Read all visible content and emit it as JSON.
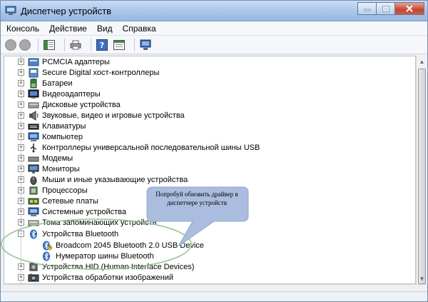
{
  "window": {
    "title": "Диспетчер устройств"
  },
  "menu": [
    "Консоль",
    "Действие",
    "Вид",
    "Справка"
  ],
  "toolbar": {
    "buttons": [
      "back",
      "forward",
      "show-hide-console-tree",
      "print",
      "help",
      "properties",
      "scan-hardware"
    ]
  },
  "tree": {
    "items": [
      {
        "label": "PCMCIA адаптеры",
        "icon": "pcmcia-icon",
        "expander": "+"
      },
      {
        "label": "Secure Digital хост-контроллеры",
        "icon": "sd-host-icon",
        "expander": "+"
      },
      {
        "label": "Батареи",
        "icon": "battery-icon",
        "expander": "+"
      },
      {
        "label": "Видеоадаптеры",
        "icon": "display-adapter-icon",
        "expander": "+"
      },
      {
        "label": "Дисковые устройства",
        "icon": "disk-drive-icon",
        "expander": "+"
      },
      {
        "label": "Звуковые, видео и игровые устройства",
        "icon": "sound-icon",
        "expander": "+"
      },
      {
        "label": "Клавиатуры",
        "icon": "keyboard-icon",
        "expander": "+"
      },
      {
        "label": "Компьютер",
        "icon": "computer-icon",
        "expander": "+"
      },
      {
        "label": "Контроллеры универсальной последовательной шины USB",
        "icon": "usb-icon",
        "expander": "+"
      },
      {
        "label": "Модемы",
        "icon": "modem-icon",
        "expander": "+"
      },
      {
        "label": "Мониторы",
        "icon": "monitor-icon",
        "expander": "+"
      },
      {
        "label": "Мыши и иные указывающие устройства",
        "icon": "mouse-icon",
        "expander": "+"
      },
      {
        "label": "Процессоры",
        "icon": "processor-icon",
        "expander": "+"
      },
      {
        "label": "Сетевые платы",
        "icon": "network-icon",
        "expander": "+"
      },
      {
        "label": "Системные устройства",
        "icon": "system-device-icon",
        "expander": "+"
      },
      {
        "label": "Тома запоминающих устройств",
        "icon": "storage-volume-icon",
        "expander": "+"
      },
      {
        "label": "Устройства Bluetooth",
        "icon": "bluetooth-icon",
        "expander": "-"
      },
      {
        "label": "Broadcom 2045 Bluetooth 2.0 USB Device",
        "icon": "bluetooth-warning-icon",
        "child": true
      },
      {
        "label": "Нумератор шины Bluetooth",
        "icon": "bluetooth-icon",
        "child": true
      },
      {
        "label": "Устройства HID (Human Interface Devices)",
        "icon": "hid-icon",
        "expander": "+"
      },
      {
        "label": "Устройства обработки изображений",
        "icon": "imaging-icon",
        "expander": "+"
      }
    ]
  },
  "callout": {
    "text": "Попробуй обновить драйвер в диспетчере устройств"
  },
  "colors": {
    "titlebar": "#a9c5e9",
    "callout_fill": "#a9bde0",
    "highlight_ellipse": "#8fc48f",
    "close_button": "#c8452c"
  }
}
